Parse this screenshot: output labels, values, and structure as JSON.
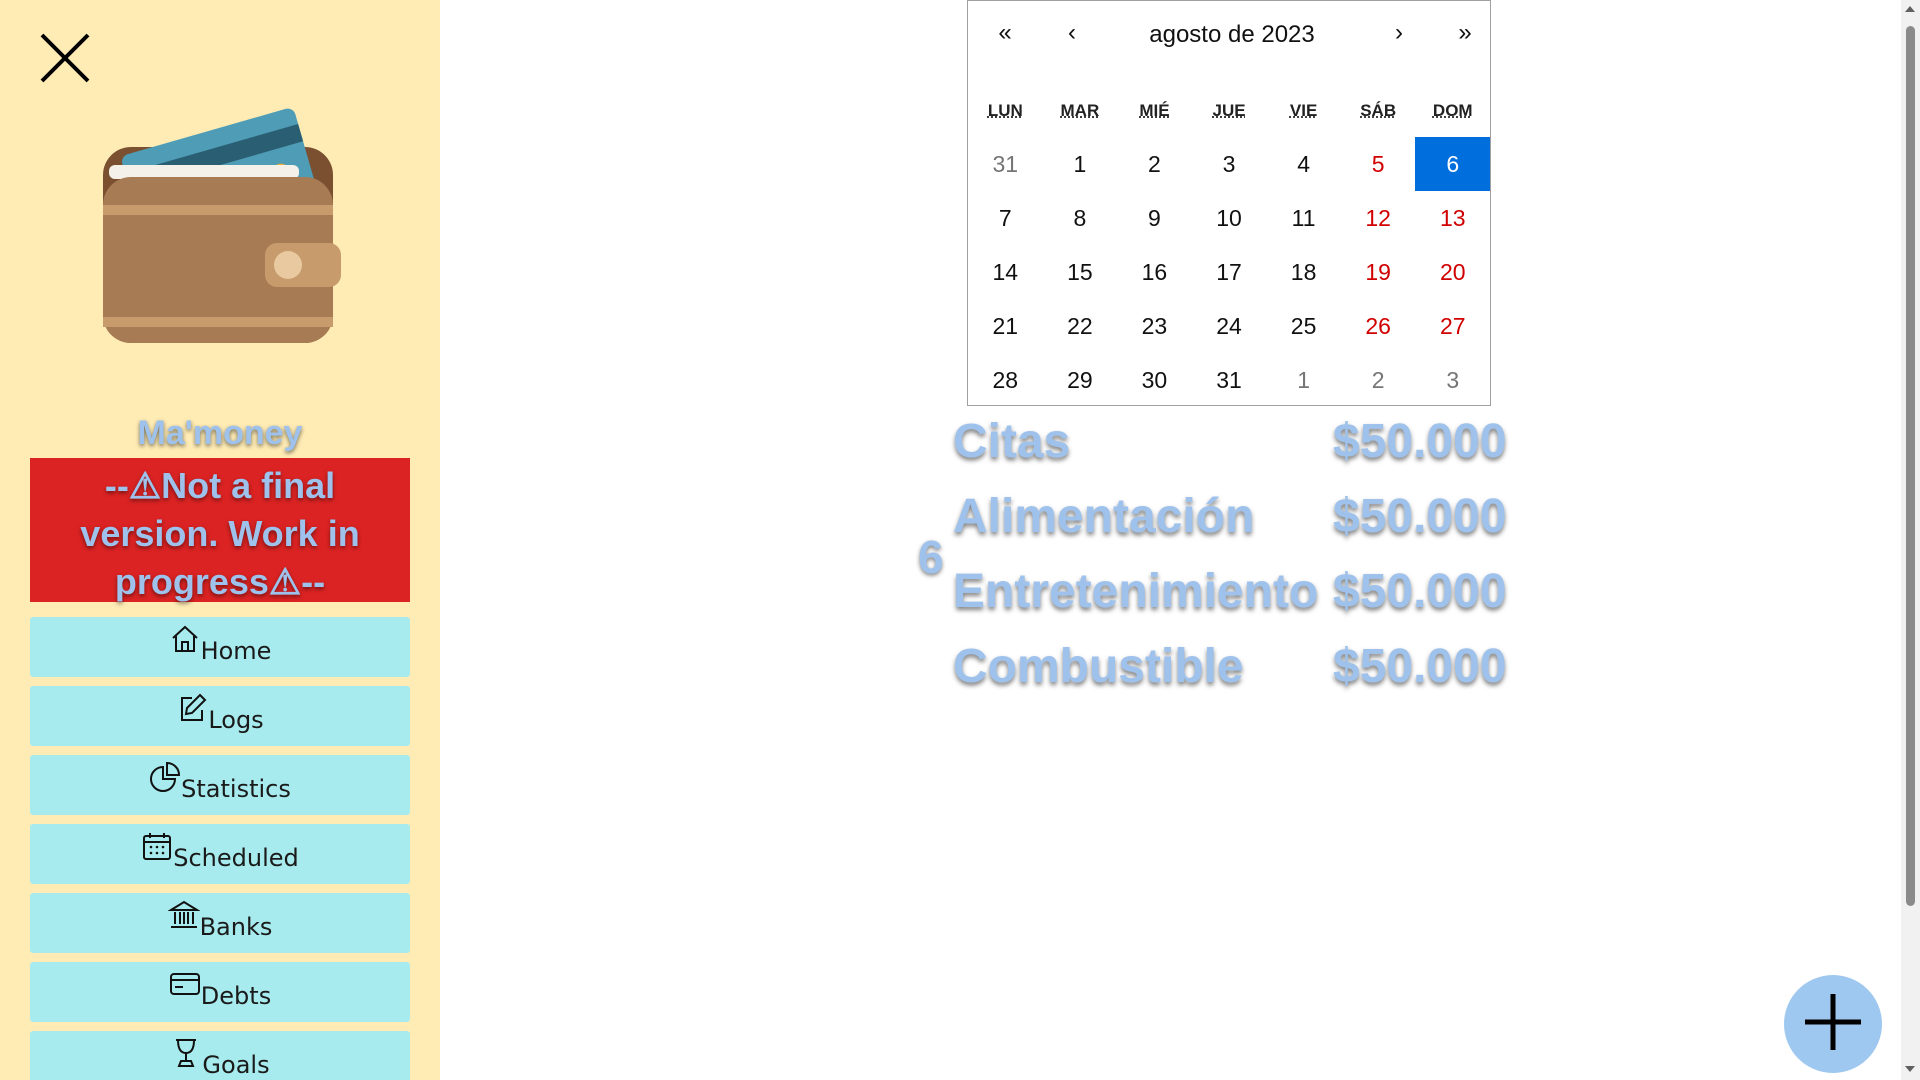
{
  "sidebar": {
    "app_name": "Ma'money",
    "warning": "--⚠Not a final version. Work in progress⚠--",
    "items": [
      {
        "label": "Home",
        "icon": "home-icon"
      },
      {
        "label": "Logs",
        "icon": "edit-icon"
      },
      {
        "label": "Statistics",
        "icon": "pie-chart-icon"
      },
      {
        "label": "Scheduled",
        "icon": "calendar-icon"
      },
      {
        "label": "Banks",
        "icon": "bank-icon"
      },
      {
        "label": "Debts",
        "icon": "credit-card-icon"
      },
      {
        "label": "Goals",
        "icon": "trophy-icon"
      }
    ]
  },
  "calendar": {
    "prev_year": "«",
    "prev_month": "‹",
    "month_label": "agosto de 2023",
    "next_month": "›",
    "next_year": "»",
    "weekdays": [
      "LUN",
      "MAR",
      "MIÉ",
      "JUE",
      "VIE",
      "SÁB",
      "DOM"
    ],
    "weeks": [
      [
        "31",
        "1",
        "2",
        "3",
        "4",
        "5",
        "6"
      ],
      [
        "7",
        "8",
        "9",
        "10",
        "11",
        "12",
        "13"
      ],
      [
        "14",
        "15",
        "16",
        "17",
        "18",
        "19",
        "20"
      ],
      [
        "21",
        "22",
        "23",
        "24",
        "25",
        "26",
        "27"
      ],
      [
        "28",
        "29",
        "30",
        "31",
        "1",
        "2",
        "3"
      ]
    ],
    "selected_day": "6",
    "selected_color": "#006edc",
    "weekend_color": "#d10000"
  },
  "selected_day_label": "6",
  "categories": [
    {
      "name": "Citas",
      "amount": "$50.000"
    },
    {
      "name": "Alimentación",
      "amount": "$50.000"
    },
    {
      "name": "Entretenimiento",
      "amount": "$50.000"
    },
    {
      "name": "Combustible",
      "amount": "$50.000"
    }
  ],
  "fab": {
    "icon": "plus-icon"
  },
  "colors": {
    "sidebar_bg": "#ffecb5",
    "nav_bg": "#a8ebee",
    "warning_bg": "#dc2323",
    "accent_text": "#9ec2ec",
    "fab_bg": "#9ec8ef"
  }
}
